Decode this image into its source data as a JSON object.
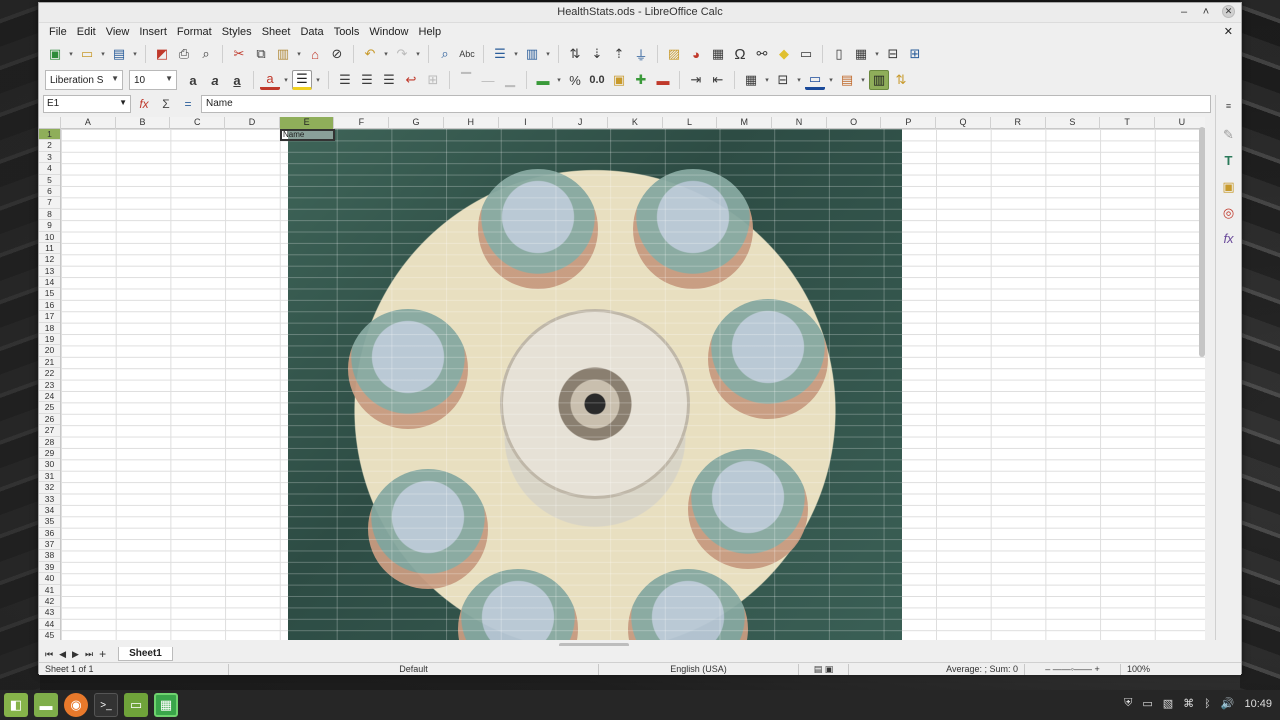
{
  "window": {
    "title": "HealthStats.ods - LibreOffice Calc"
  },
  "menu": [
    "File",
    "Edit",
    "View",
    "Insert",
    "Format",
    "Styles",
    "Sheet",
    "Data",
    "Tools",
    "Window",
    "Help"
  ],
  "format_toolbar": {
    "font_name": "Liberation S",
    "font_size": "10"
  },
  "formula_bar": {
    "cell_ref": "E1",
    "content": "Name"
  },
  "columns": [
    "A",
    "B",
    "C",
    "D",
    "E",
    "F",
    "G",
    "H",
    "I",
    "J",
    "K",
    "L",
    "M",
    "N",
    "O",
    "P",
    "Q",
    "R",
    "S",
    "T",
    "U"
  ],
  "selected_column": "E",
  "rows": [
    "1",
    "2",
    "3",
    "4",
    "5",
    "6",
    "7",
    "8",
    "9",
    "10",
    "11",
    "12",
    "13",
    "14",
    "15",
    "16",
    "17",
    "18",
    "19",
    "20",
    "21",
    "22",
    "23",
    "24",
    "25",
    "26",
    "27",
    "28",
    "29",
    "30",
    "31",
    "32",
    "33",
    "34",
    "35",
    "36",
    "37",
    "38",
    "39",
    "40",
    "41",
    "42",
    "43",
    "44",
    "45"
  ],
  "cell_e1": "Name",
  "sheet_tab": "Sheet1",
  "status": {
    "sheet": "Sheet 1 of 1",
    "page_style": "Default",
    "language": "English (USA)",
    "summary": "Average: ; Sum: 0",
    "zoom": "100%"
  },
  "taskbar": {
    "clock": "10:49"
  },
  "colors": {
    "selection": "#8fae5a",
    "accent": "#3aa64a"
  }
}
